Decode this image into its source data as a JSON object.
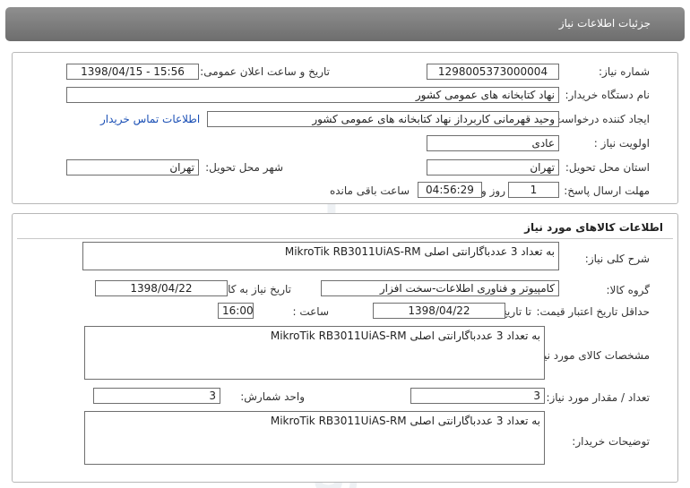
{
  "header": {
    "title": "جزئیات اطلاعات نیاز"
  },
  "watermark": {
    "brand": "ParsNamadar",
    "slogan": "پایگاه اطلاع رسانی مناقصه ومزایده",
    "phone": "۰۲۱-۸۸۳۴۹۶۷۰-۵",
    "digits": "021-88349670"
  },
  "need_info": {
    "need_number_label": "شماره نیاز:",
    "need_number": "1298005373000004",
    "announce_label": "تاریخ و ساعت اعلان عمومی:",
    "announce_value": "1398/04/15 - 15:56",
    "buyer_org_label": "نام دستگاه خریدار:",
    "buyer_org": "نهاد کتابخانه های عمومی کشور",
    "requester_label": "ایجاد کننده درخواست:",
    "requester": "وحید  قهرمانی کاربرداز نهاد کتابخانه های عمومی کشور",
    "contact_link": "اطلاعات تماس خریدار",
    "priority_label": "اولویت نیاز :",
    "priority": "عادی",
    "province_label": "استان محل تحویل:",
    "province": "تهران",
    "city_label": "شهر محل تحویل:",
    "city": "تهران",
    "deadline_label": "مهلت ارسال پاسخ:",
    "days": "1",
    "days_label": "روز و",
    "time_left": "04:56:29",
    "time_left_label": "ساعت باقی مانده"
  },
  "goods_info": {
    "title": "اطلاعات کالاهای مورد نیاز",
    "summary_label": "شرح کلی نیاز:",
    "summary": "به تعداد 3 عددباگارانتی اصلی MikroTik RB3011UiAS-RM",
    "group_label": "گروه کالا:",
    "group": "کامپیوتر و فناوری اطلاعات-سخت افزار",
    "need_date_label": "تاریخ نیاز به کالا:",
    "need_date": "1398/04/22",
    "validity_label": "حداقل تاریخ اعتبار قیمت:",
    "until_date_label": "تا تاریخ :",
    "until_date": "1398/04/22",
    "hour_label": "ساعت :",
    "hour": "16:00",
    "specs_label": "مشخصات کالای مورد نیاز:",
    "specs": "به تعداد 3 عددباگارانتی اصلی MikroTik RB3011UiAS-RM",
    "quantity_label": "تعداد / مقدار مورد نیاز:",
    "quantity": "3",
    "unit_label": "واحد شمارش:",
    "unit": "3",
    "buyer_notes_label": "توضیحات خریدار:",
    "buyer_notes": "به تعداد 3 عددباگارانتی اصلی MikroTik RB3011UiAS-RM"
  }
}
